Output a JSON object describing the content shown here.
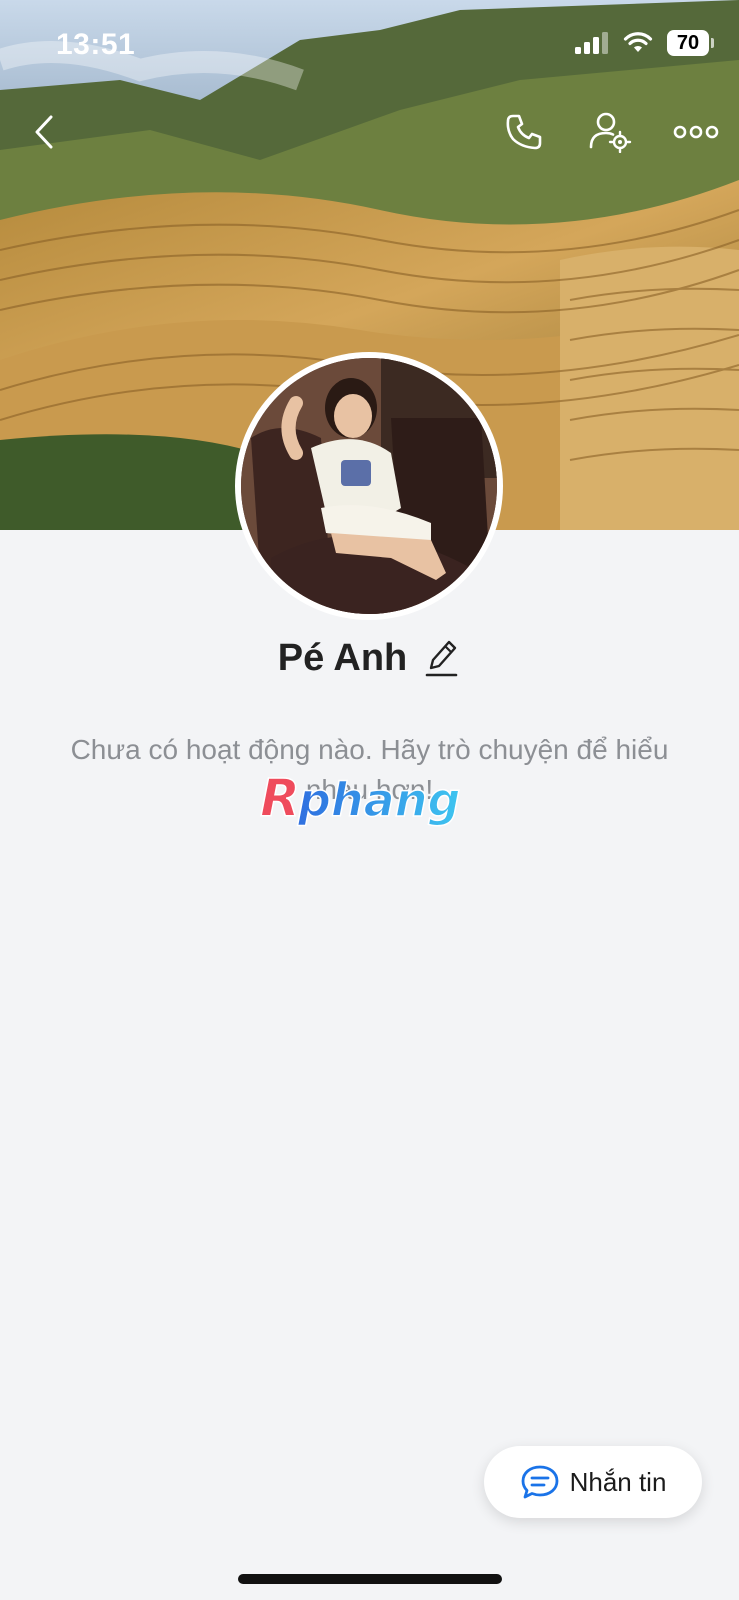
{
  "status_bar": {
    "time": "13:51",
    "battery": "70",
    "signal_icon": "cellular-signal-icon",
    "wifi_icon": "wifi-icon"
  },
  "header": {
    "back_icon": "back-chevron-icon",
    "call_icon": "phone-icon",
    "settings_icon": "user-settings-icon",
    "more_icon": "more-dots-icon",
    "icon_color": "#ffffff"
  },
  "profile": {
    "name": "Pé Anh",
    "edit_icon": "pencil-icon",
    "activity_text": "Chưa có hoạt động nào. Hãy trò chuyện để hiểu nhau hơn!"
  },
  "watermark": {
    "text": "Rphang"
  },
  "actions": {
    "message_label": "Nhắn tin",
    "message_icon": "chat-bubble-icon",
    "accent_color": "#1a73e8"
  },
  "colors": {
    "background": "#f3f4f6",
    "name_text": "#222222",
    "activity_text": "#8c8f94"
  }
}
